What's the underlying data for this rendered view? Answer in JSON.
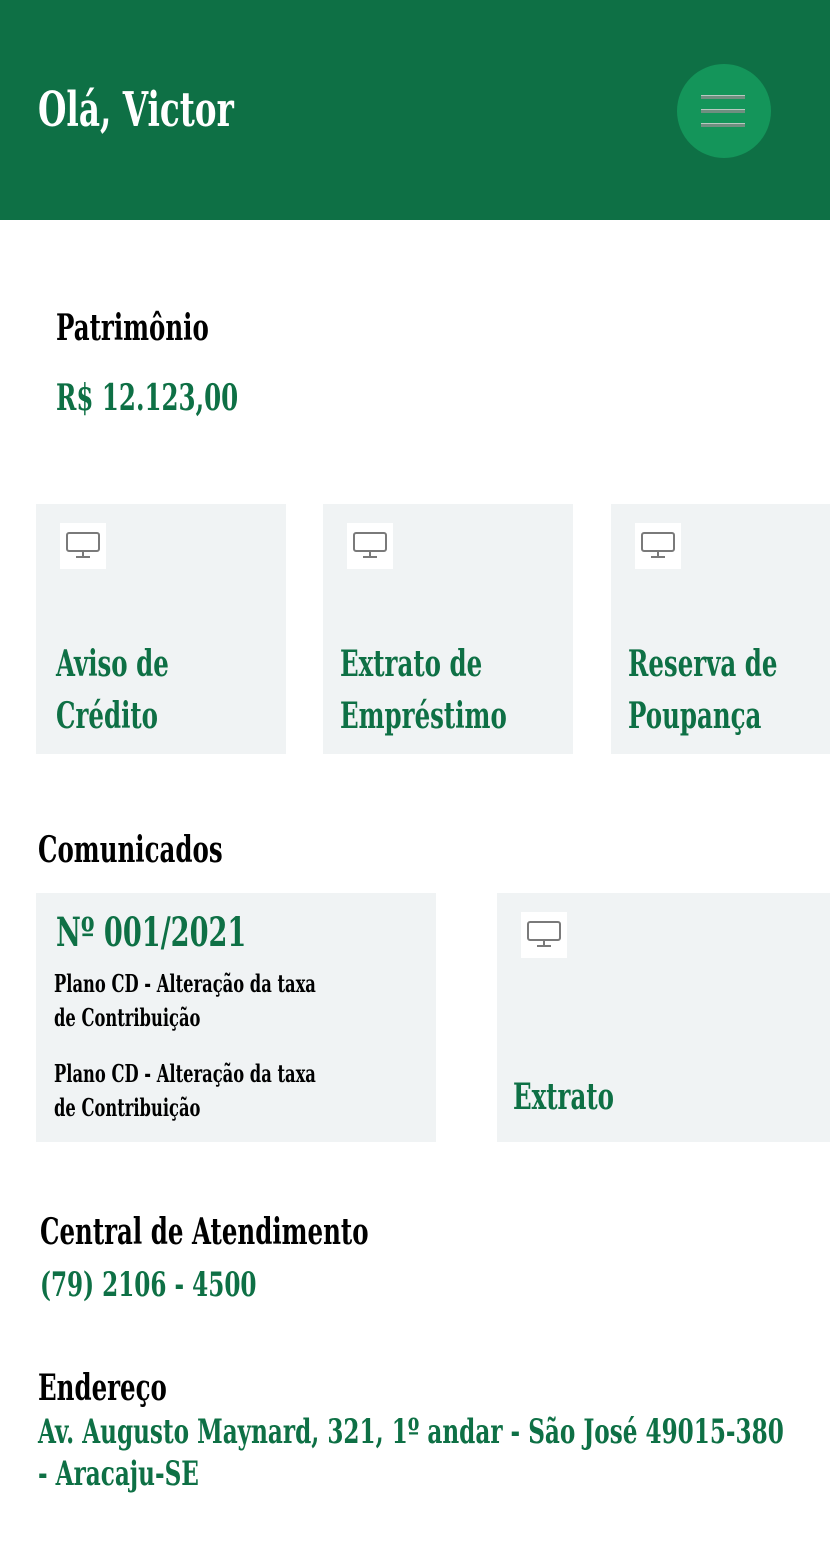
{
  "header": {
    "greeting": "Olá, Victor",
    "menu_icon": "hamburger-menu-icon"
  },
  "patrimonio": {
    "label": "Patrimônio",
    "value": "R$ 12.123,00"
  },
  "cards": [
    {
      "icon": "monitor-icon",
      "line1": "Aviso de",
      "line2": "Crédito"
    },
    {
      "icon": "monitor-icon",
      "line1": "Extrato de",
      "line2": "Empréstimo"
    },
    {
      "icon": "monitor-icon",
      "line1": "Reserva de",
      "line2": "Poupança"
    }
  ],
  "comunicados": {
    "title": "Comunicados",
    "notice": {
      "number": "Nº 001/2021",
      "items": [
        {
          "line1": "Plano CD - Alteração da taxa",
          "line2": "de Contribuição"
        },
        {
          "line1": "Plano CD - Alteração da taxa",
          "line2": "de Contribuição"
        }
      ]
    },
    "extrato_card": {
      "icon": "monitor-icon",
      "label": "Extrato"
    }
  },
  "central": {
    "label": "Central de Atendimento",
    "phone": "(79) 2106 - 4500"
  },
  "endereco": {
    "label": "Endereço",
    "line1": "Av. Augusto Maynard, 321, 1º andar - São José 49015-380",
    "line2": "- Aracaju-SE"
  },
  "colors": {
    "brand_green": "#0e7045",
    "menu_button": "#14955a",
    "card_background": "#f0f3f4"
  }
}
